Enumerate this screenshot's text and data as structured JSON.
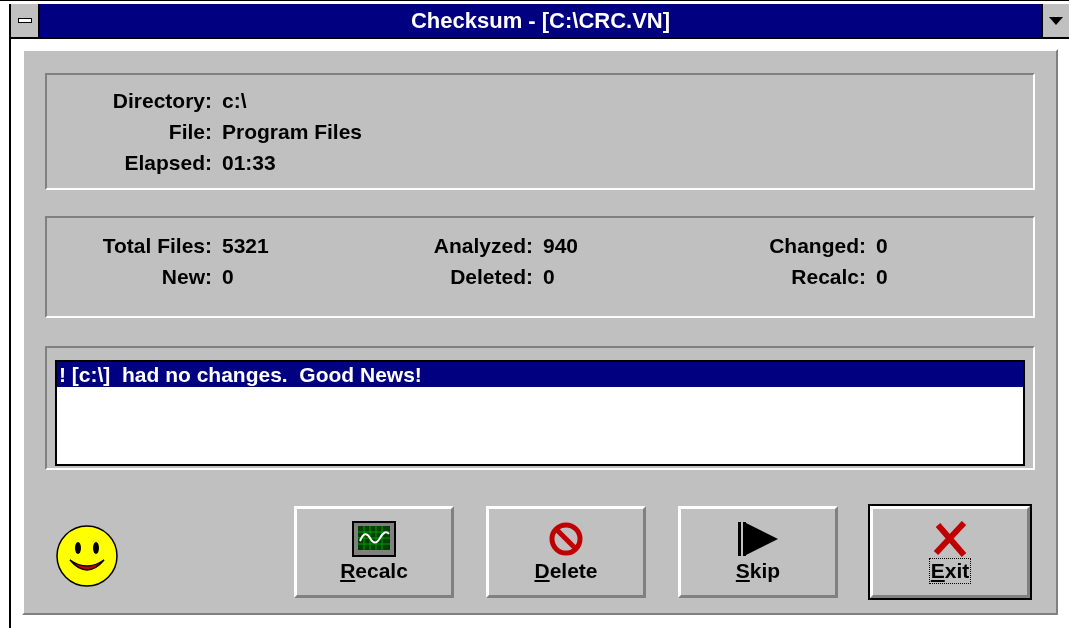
{
  "window": {
    "title": "Checksum - [C:\\CRC.VN]"
  },
  "location": [
    {
      "label": "Directory:",
      "value": "c:\\"
    },
    {
      "label": "File:",
      "value": "Program Files"
    },
    {
      "label": "Elapsed:",
      "value": "01:33"
    }
  ],
  "stats": [
    {
      "label": "Total Files:",
      "value": "5321"
    },
    {
      "label": "Analyzed:",
      "value": "940"
    },
    {
      "label": "Changed:",
      "value": "0"
    },
    {
      "label": "New:",
      "value": "0"
    },
    {
      "label": "Deleted:",
      "value": "0"
    },
    {
      "label": "Recalc:",
      "value": "0"
    }
  ],
  "messages": [
    {
      "text": "! [c:\\]  had no changes.  Good News!",
      "selected": true
    }
  ],
  "buttons": [
    {
      "kind": "recalc",
      "key": "R",
      "rest": "ecalc",
      "focused": false
    },
    {
      "kind": "delete",
      "key": "D",
      "rest": "elete",
      "focused": false
    },
    {
      "kind": "skip",
      "key": "S",
      "rest": "kip",
      "focused": false
    },
    {
      "kind": "exit",
      "key": "E",
      "rest": "xit",
      "focused": true
    }
  ]
}
